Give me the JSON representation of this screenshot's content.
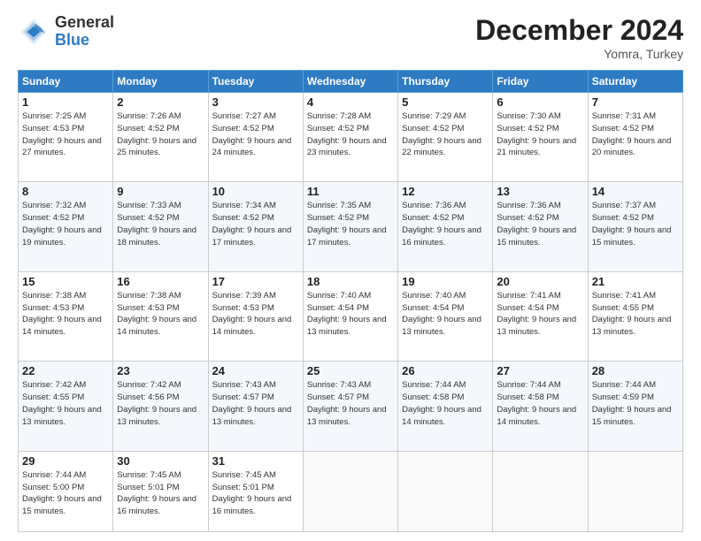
{
  "header": {
    "logo_general": "General",
    "logo_blue": "Blue",
    "title": "December 2024",
    "location": "Yomra, Turkey"
  },
  "days_of_week": [
    "Sunday",
    "Monday",
    "Tuesday",
    "Wednesday",
    "Thursday",
    "Friday",
    "Saturday"
  ],
  "weeks": [
    [
      {
        "day": 1,
        "sunrise": "7:25 AM",
        "sunset": "4:53 PM",
        "daylight": "9 hours and 27 minutes."
      },
      {
        "day": 2,
        "sunrise": "7:26 AM",
        "sunset": "4:52 PM",
        "daylight": "9 hours and 25 minutes."
      },
      {
        "day": 3,
        "sunrise": "7:27 AM",
        "sunset": "4:52 PM",
        "daylight": "9 hours and 24 minutes."
      },
      {
        "day": 4,
        "sunrise": "7:28 AM",
        "sunset": "4:52 PM",
        "daylight": "9 hours and 23 minutes."
      },
      {
        "day": 5,
        "sunrise": "7:29 AM",
        "sunset": "4:52 PM",
        "daylight": "9 hours and 22 minutes."
      },
      {
        "day": 6,
        "sunrise": "7:30 AM",
        "sunset": "4:52 PM",
        "daylight": "9 hours and 21 minutes."
      },
      {
        "day": 7,
        "sunrise": "7:31 AM",
        "sunset": "4:52 PM",
        "daylight": "9 hours and 20 minutes."
      }
    ],
    [
      {
        "day": 8,
        "sunrise": "7:32 AM",
        "sunset": "4:52 PM",
        "daylight": "9 hours and 19 minutes."
      },
      {
        "day": 9,
        "sunrise": "7:33 AM",
        "sunset": "4:52 PM",
        "daylight": "9 hours and 18 minutes."
      },
      {
        "day": 10,
        "sunrise": "7:34 AM",
        "sunset": "4:52 PM",
        "daylight": "9 hours and 17 minutes."
      },
      {
        "day": 11,
        "sunrise": "7:35 AM",
        "sunset": "4:52 PM",
        "daylight": "9 hours and 17 minutes."
      },
      {
        "day": 12,
        "sunrise": "7:36 AM",
        "sunset": "4:52 PM",
        "daylight": "9 hours and 16 minutes."
      },
      {
        "day": 13,
        "sunrise": "7:36 AM",
        "sunset": "4:52 PM",
        "daylight": "9 hours and 15 minutes."
      },
      {
        "day": 14,
        "sunrise": "7:37 AM",
        "sunset": "4:52 PM",
        "daylight": "9 hours and 15 minutes."
      }
    ],
    [
      {
        "day": 15,
        "sunrise": "7:38 AM",
        "sunset": "4:53 PM",
        "daylight": "9 hours and 14 minutes."
      },
      {
        "day": 16,
        "sunrise": "7:38 AM",
        "sunset": "4:53 PM",
        "daylight": "9 hours and 14 minutes."
      },
      {
        "day": 17,
        "sunrise": "7:39 AM",
        "sunset": "4:53 PM",
        "daylight": "9 hours and 14 minutes."
      },
      {
        "day": 18,
        "sunrise": "7:40 AM",
        "sunset": "4:54 PM",
        "daylight": "9 hours and 13 minutes."
      },
      {
        "day": 19,
        "sunrise": "7:40 AM",
        "sunset": "4:54 PM",
        "daylight": "9 hours and 13 minutes."
      },
      {
        "day": 20,
        "sunrise": "7:41 AM",
        "sunset": "4:54 PM",
        "daylight": "9 hours and 13 minutes."
      },
      {
        "day": 21,
        "sunrise": "7:41 AM",
        "sunset": "4:55 PM",
        "daylight": "9 hours and 13 minutes."
      }
    ],
    [
      {
        "day": 22,
        "sunrise": "7:42 AM",
        "sunset": "4:55 PM",
        "daylight": "9 hours and 13 minutes."
      },
      {
        "day": 23,
        "sunrise": "7:42 AM",
        "sunset": "4:56 PM",
        "daylight": "9 hours and 13 minutes."
      },
      {
        "day": 24,
        "sunrise": "7:43 AM",
        "sunset": "4:57 PM",
        "daylight": "9 hours and 13 minutes."
      },
      {
        "day": 25,
        "sunrise": "7:43 AM",
        "sunset": "4:57 PM",
        "daylight": "9 hours and 13 minutes."
      },
      {
        "day": 26,
        "sunrise": "7:44 AM",
        "sunset": "4:58 PM",
        "daylight": "9 hours and 14 minutes."
      },
      {
        "day": 27,
        "sunrise": "7:44 AM",
        "sunset": "4:58 PM",
        "daylight": "9 hours and 14 minutes."
      },
      {
        "day": 28,
        "sunrise": "7:44 AM",
        "sunset": "4:59 PM",
        "daylight": "9 hours and 15 minutes."
      }
    ],
    [
      {
        "day": 29,
        "sunrise": "7:44 AM",
        "sunset": "5:00 PM",
        "daylight": "9 hours and 15 minutes."
      },
      {
        "day": 30,
        "sunrise": "7:45 AM",
        "sunset": "5:01 PM",
        "daylight": "9 hours and 16 minutes."
      },
      {
        "day": 31,
        "sunrise": "7:45 AM",
        "sunset": "5:01 PM",
        "daylight": "9 hours and 16 minutes."
      },
      null,
      null,
      null,
      null
    ]
  ]
}
